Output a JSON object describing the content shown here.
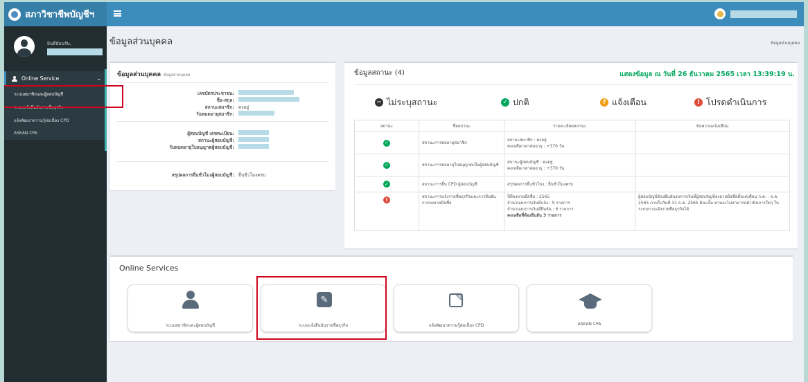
{
  "app": {
    "title": "สภาวิชาชีพบัญชีฯ"
  },
  "user": {
    "greeting": "ยินดีต้อนรับ,"
  },
  "sidebar": {
    "menu_header": "Online Service",
    "items": [
      {
        "label": "ระบบสมาชิกและผู้สอบบัญชี"
      },
      {
        "label": "ระบบแจ้งยืนยันรายชื่อธุรกิจ"
      },
      {
        "label": "แจ้งพัฒนาความรู้ต่อเนื่อง CPD"
      },
      {
        "label": "ASEAN CPA"
      }
    ]
  },
  "page": {
    "title": "ข้อมูลส่วนบุคคล",
    "breadcrumb": "ข้อมูลส่วนบุคคล"
  },
  "personal": {
    "title": "ข้อมูลส่วนบุคคล",
    "subtitle": "ข้อมูลส่วนบุคคล",
    "id_label": "เลขบัตรประชาชน:",
    "name_label": "ชื่อ-สกุล:",
    "member_status_label": "สถานะสมาชิก:",
    "member_status_value": "คงอยู่",
    "member_expiry_label": "วันหมดอายุสมาชิก:",
    "auditor_no_label": "ผู้สอบบัญชี เลขทะเบียน:",
    "auditor_status_label": "สถานะผู้สอบบัญชี:",
    "license_expiry_label": "วันหมดอายุใบอนุญาตผู้สอบบัญชี:",
    "cpd_summary_label": "สรุปผลการยื่นชั่วโมงผู้สอบบัญชี:",
    "cpd_summary_value": "ยื่นชั่วโมงครบ"
  },
  "status_box": {
    "title": "ข้อมูลสถานะ (4)",
    "timestamp": "แสดงข้อมูล ณ วันที่ 26 ธันวาคม 2565 เวลา 13:39:19 น.",
    "legend": [
      {
        "label": "ไม่ระบุสถานะ",
        "color": "#333333",
        "icon": "minus-circle-icon"
      },
      {
        "label": "ปกติ",
        "color": "#00a65a",
        "icon": "check-circle-icon"
      },
      {
        "label": "แจ้งเตือน",
        "color": "#f39c12",
        "icon": "question-circle-icon"
      },
      {
        "label": "โปรดดำเนินการ",
        "color": "#dd4b39",
        "icon": "exclamation-circle-icon"
      }
    ],
    "columns": [
      "สถานะ",
      "ชื่อสถานะ",
      "รายละเอียดสถานะ",
      "ข้อความแจ้งเตือน"
    ],
    "rows": [
      {
        "state": "ok",
        "name": "สถานะการต่ออายุสมาชิก",
        "detail": [
          "สถานะสมาชิก : คงอยู่",
          "คงเหลือเวลาต่ออายุ : +370 วัน"
        ],
        "message": ""
      },
      {
        "state": "ok",
        "name": "สถานะการต่ออายุใบอนุญาตเป็นผู้สอบบัญชี",
        "detail": [
          "สถานะผู้สอบบัญชี : คงอยู่",
          "คงเหลือเวลาต่ออายุ : +370 วัน"
        ],
        "message": ""
      },
      {
        "state": "ok",
        "name": "สถานะการยื่น CPD ผู้สอบบัญชี",
        "detail": [
          "สรุปผลการยื่นชั่วโมง : ยื่นชั่วโมงครบ"
        ],
        "message": ""
      },
      {
        "state": "bad",
        "name": "สถานะการแจ้งรายชื่อธุรกิจและการยืนยันการลงลายมือชื่อ",
        "detail": [
          "ปีที่ลงลายมือชื่อ : 2565",
          "จำนวนงบการเงินที่แจ้ง : 9 รายการ",
          "จำนวนงบการเงินที่ยืนยัน : 6 รายการ"
        ],
        "detail_bold": "คงเหลือที่ต้องยืนยัน 3 รายการ",
        "message": "ผู้สอบบัญชีต้องยืนยันงบการเงินที่ผู้สอบบัญชีลงลายมือชื่อตั้งแต่เดือน ก.ค. - ธ.ค. 2565 ภายในวันที่ 31 ธ.ค. 2565 มิฉะนั้น ท่านจะไม่สามารถดำเนินการใดๆ ในระบบการแจ้งรายชื่อธุรกิจได้"
      }
    ]
  },
  "services": {
    "title": "Online Services",
    "items": [
      {
        "label": "ระบบสมาชิกและผู้สอบบัญชี",
        "icon": "user-icon"
      },
      {
        "label": "ระบบแจ้งยืนยันรายชื่อธุรกิจ",
        "icon": "pencil-square-icon"
      },
      {
        "label": "แจ้งพัฒนาความรู้ต่อเนื่อง CPD",
        "icon": "edit-icon"
      },
      {
        "label": "ASEAN CPA",
        "icon": "graduation-cap-icon"
      }
    ]
  }
}
